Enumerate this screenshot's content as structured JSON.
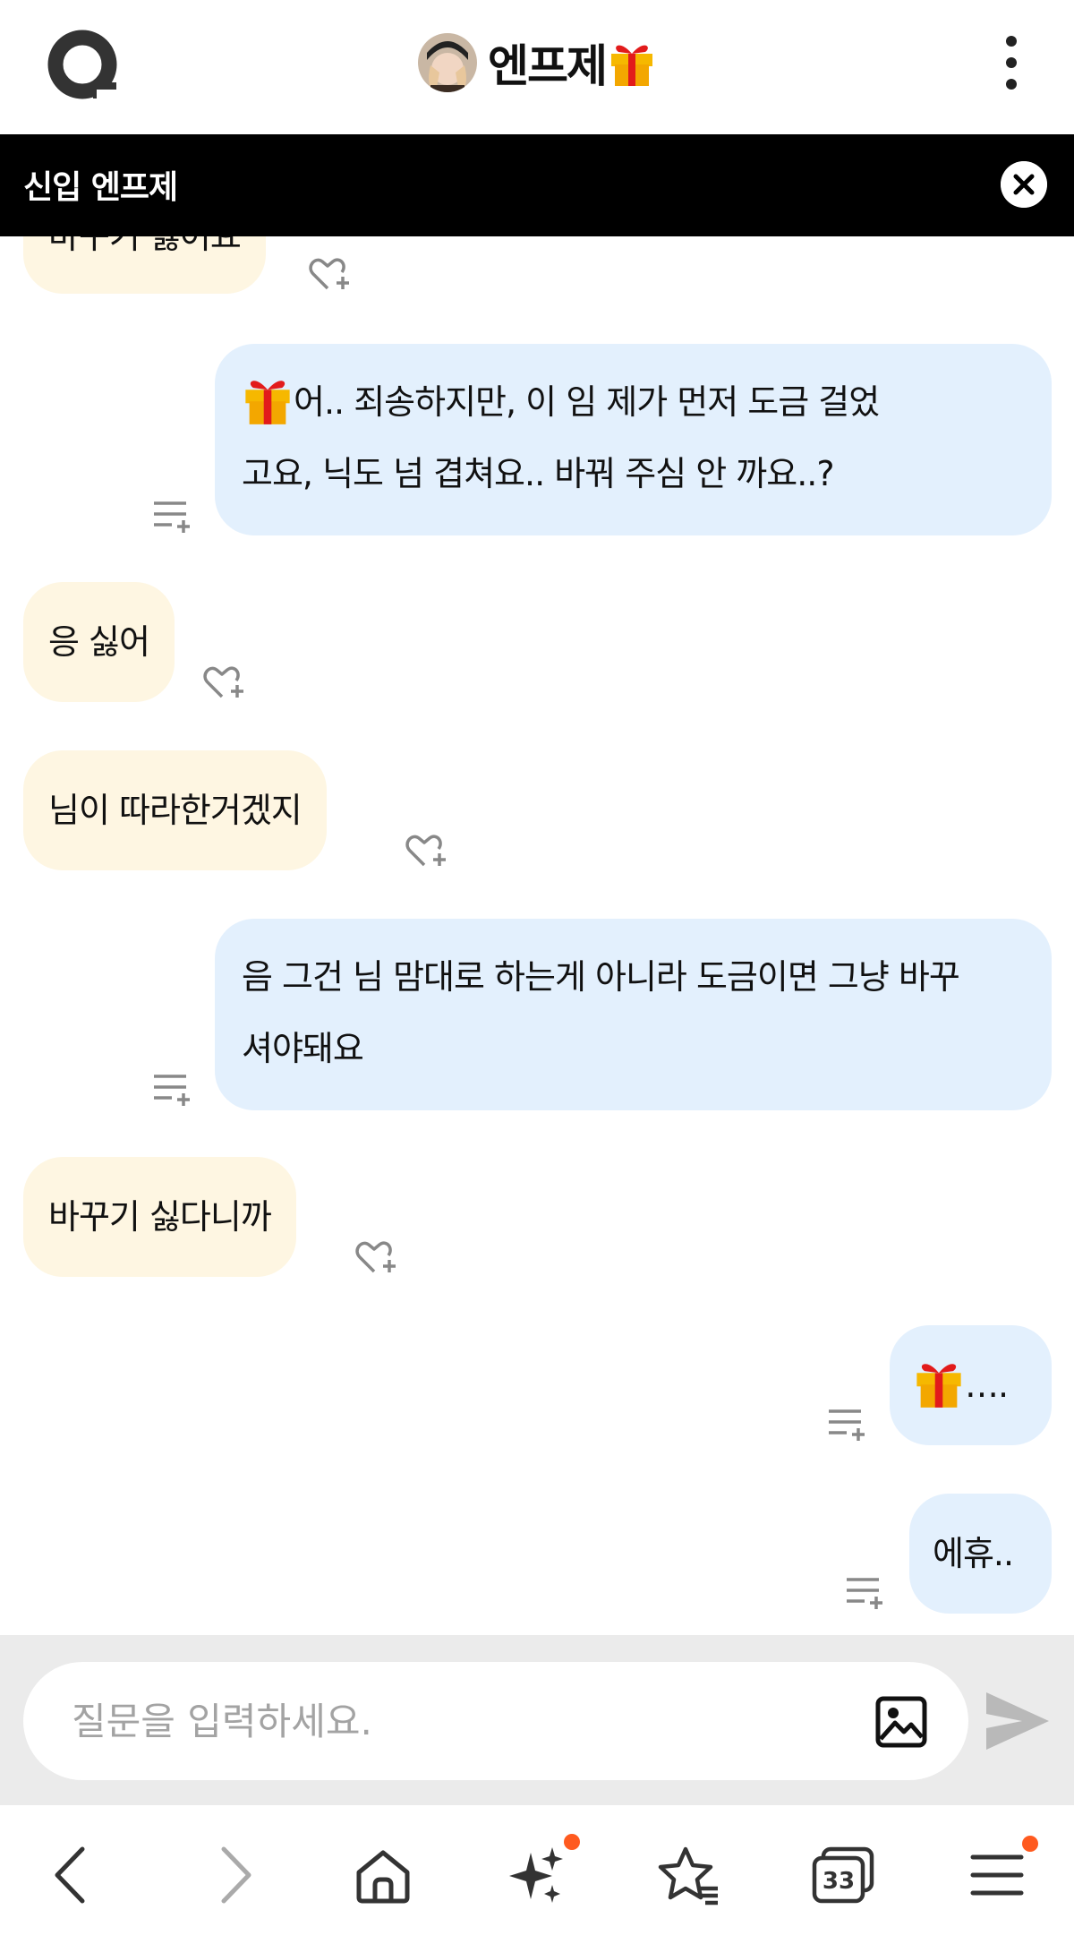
{
  "header": {
    "title": "엔프제",
    "logo_icon": "q-logo-icon",
    "menu_icon": "kebab-menu-icon"
  },
  "banner": {
    "label": "신입 엔프제",
    "close_icon": "close-icon"
  },
  "messages": [
    {
      "role": "bot",
      "lines": [
        "바꾸기 싫어요"
      ],
      "partial": true
    },
    {
      "role": "user",
      "lines": [
        "어.. 죄송하지만, 이      임 제가 먼저 도금 걸었",
        "고요, 닉도 넘 겹쳐요.. 바꿔 주심 안     까요..?"
      ],
      "has_gift": true
    },
    {
      "role": "bot",
      "lines": [
        "응 싫어"
      ]
    },
    {
      "role": "bot",
      "lines": [
        "님이 따라한거겠지"
      ]
    },
    {
      "role": "user",
      "lines": [
        "음 그건 님 맘대로 하는게 아니라 도금이면 그냥 바꾸",
        "셔야돼요"
      ]
    },
    {
      "role": "bot",
      "lines": [
        "바꾸기 싫다니까"
      ]
    },
    {
      "role": "user",
      "lines": [
        "…."
      ],
      "has_gift": true
    },
    {
      "role": "user",
      "lines": [
        "에휴.."
      ]
    }
  ],
  "input": {
    "placeholder": "질문을 입력하세요.",
    "value": ""
  },
  "bottom_nav": {
    "tab_count": "33",
    "items": [
      "back-icon",
      "forward-icon",
      "home-icon",
      "sparkle-icon",
      "bookmark-star-icon",
      "tabs-icon",
      "hamburger-menu-icon"
    ]
  },
  "colors": {
    "bot_bubble": "#fef6e2",
    "user_bubble": "#e3f0fd",
    "banner_bg": "#000000",
    "input_bar_bg": "#ebebeb",
    "notification_dot": "#ff5a1f"
  }
}
